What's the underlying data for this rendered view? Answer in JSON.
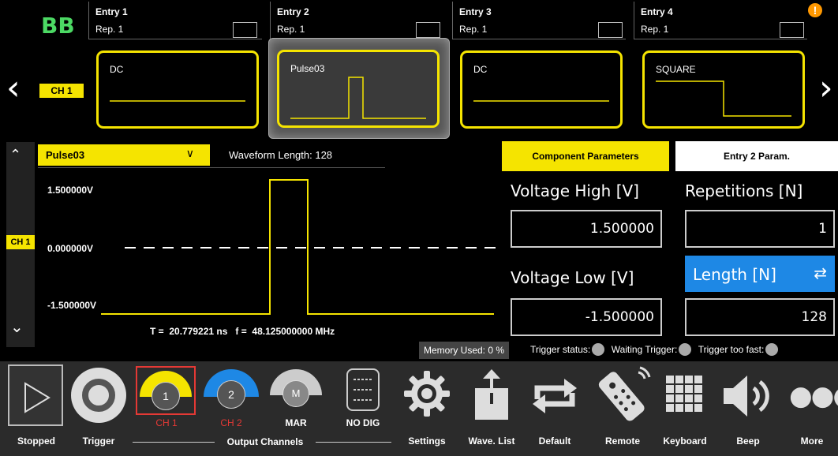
{
  "brand": "BB",
  "alert_icon": "exclamation-icon",
  "entries": [
    {
      "title": "Entry 1",
      "rep": "Rep. 1",
      "waveform": "DC"
    },
    {
      "title": "Entry 2",
      "rep": "Rep. 1",
      "waveform": "Pulse03"
    },
    {
      "title": "Entry 3",
      "rep": "Rep. 1",
      "waveform": "DC"
    },
    {
      "title": "Entry 4",
      "rep": "Rep. 1",
      "waveform": "SQUARE"
    }
  ],
  "channel_tag": "CH 1",
  "editor": {
    "waveform_select": "Pulse03",
    "waveform_length": "Waveform Length: 128",
    "channel": "CH 1",
    "volt_high": "1.500000V",
    "volt_zero": "0.000000V",
    "volt_low": "-1.500000V",
    "timing": "T =  20.779221 ns   f =  48.125000000 MHz"
  },
  "params": {
    "tab_component": "Component Parameters",
    "tab_entry": "Entry  2  Param.",
    "voltage_high_label": "Voltage High [V]",
    "voltage_high_value": "1.500000",
    "repetitions_label": "Repetitions [N]",
    "repetitions_value": "1",
    "voltage_low_label": "Voltage Low [V]",
    "voltage_low_value": "-1.500000",
    "length_label": "Length [N]",
    "length_value": "128"
  },
  "status": {
    "memory": "Memory Used:  0 %",
    "trigger_status": "Trigger status:",
    "waiting_trigger": "Waiting Trigger:",
    "trigger_too_fast": "Trigger too fast:"
  },
  "toolbar": {
    "stopped": "Stopped",
    "trigger": "Trigger",
    "ch1_num": "1",
    "ch1": "CH 1",
    "ch2_num": "2",
    "ch2": "CH 2",
    "mar_letter": "M",
    "mar": "MAR",
    "nodig": "NO DIG",
    "output_channels": "Output Channels",
    "settings": "Settings",
    "wave_list": "Wave. List",
    "default": "Default",
    "remote": "Remote",
    "keyboard": "Keyboard",
    "beep": "Beep",
    "more": "More"
  },
  "colors": {
    "accent_yellow": "#f5e400",
    "accent_blue": "#1e88e5",
    "brand_green": "#4cd964",
    "ch_red": "#e53935"
  }
}
